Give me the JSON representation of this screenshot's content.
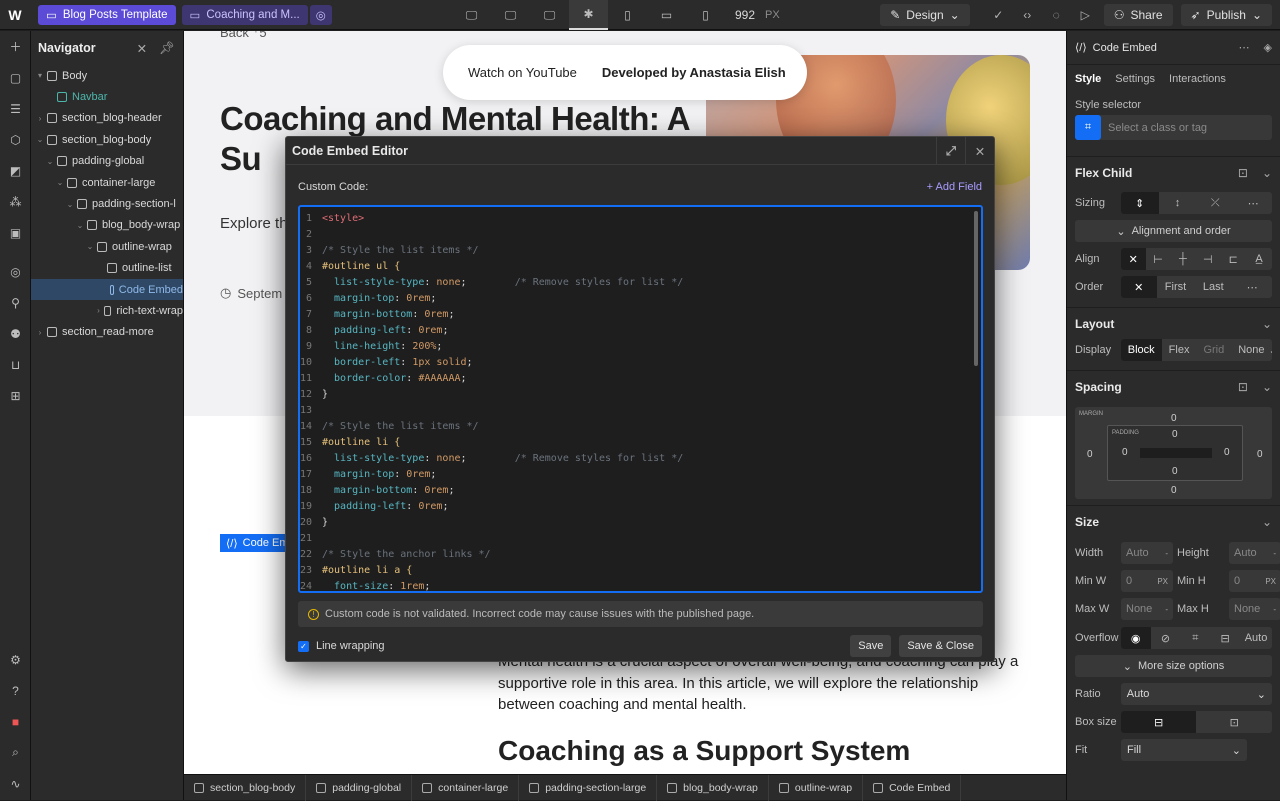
{
  "topbar": {
    "tabs": [
      "Blog Posts Template",
      "Coaching and M..."
    ],
    "breakpoint_size": "992",
    "breakpoint_unit": "PX",
    "mode_label": "Design",
    "share_label": "Share",
    "publish_label": "Publish"
  },
  "navigator": {
    "title": "Navigator",
    "items": [
      {
        "label": "Body",
        "depth": 0
      },
      {
        "label": "Navbar",
        "depth": 1
      },
      {
        "label": "section_blog-header",
        "depth": 1
      },
      {
        "label": "section_blog-body",
        "depth": 1
      },
      {
        "label": "padding-global",
        "depth": 2
      },
      {
        "label": "container-large",
        "depth": 3
      },
      {
        "label": "padding-section-l",
        "depth": 4
      },
      {
        "label": "blog_body-wrap",
        "depth": 5
      },
      {
        "label": "outline-wrap",
        "depth": 6
      },
      {
        "label": "outline-list",
        "depth": 7
      },
      {
        "label": "Code Embed",
        "depth": 7
      },
      {
        "label": "rich-text-wrap",
        "depth": 6
      },
      {
        "label": "section_read-more",
        "depth": 1
      }
    ]
  },
  "canvas": {
    "back_text": "Back ⁺5",
    "pill_left": "Watch on YouTube",
    "pill_right": "Developed by Anastasia Elish",
    "hero_title": "Coaching and Mental Health: A Su",
    "hero_sub": "Explore th how it can",
    "hero_date": "Septem",
    "code_embed_tag": "Code Emb",
    "body_text": "Mental health is a crucial aspect of overall well-being, and coaching can play a supportive role in this area. In this article, we will explore the relationship between coaching and mental health.",
    "h2": "Coaching as a Support System"
  },
  "breadcrumb": [
    "section_blog-body",
    "padding-global",
    "container-large",
    "padding-section-large",
    "blog_body-wrap",
    "outline-wrap",
    "Code Embed"
  ],
  "modal": {
    "title": "Code Embed Editor",
    "custom_code_label": "Custom Code:",
    "add_field": "+ Add Field",
    "code_lines": [
      "<style>",
      "",
      "/* Style the list items */",
      "#outline ul {",
      "  list-style-type: none;        /* Remove styles for list */",
      "  margin-top: 0rem;",
      "  margin-bottom: 0rem;",
      "  padding-left: 0rem;",
      "  line-height: 200%;",
      "  border-left: 1px solid;",
      "  border-color: #AAAAAA;",
      "}",
      "",
      "/* Style the list items */",
      "#outline li {",
      "  list-style-type: none;        /* Remove styles for list */",
      "  margin-top: 0rem;",
      "  margin-bottom: 0rem;",
      "  padding-left: 0rem;",
      "}",
      "",
      "/* Style the anchor links */",
      "#outline li a {",
      "  font-size: 1rem;"
    ],
    "warning": "Custom code is not validated. Incorrect code may cause issues with the published page.",
    "line_wrapping": "Line wrapping",
    "save": "Save",
    "save_close": "Save & Close"
  },
  "right_panel": {
    "element": "Code Embed",
    "tabs": [
      "Style",
      "Settings",
      "Interactions"
    ],
    "style_selector_label": "Style selector",
    "style_selector_placeholder": "Select a class or tag",
    "flex_child": {
      "title": "Flex Child",
      "sizing": "Sizing",
      "alignment": "Alignment and order",
      "align": "Align",
      "order": "Order",
      "first": "First",
      "last": "Last"
    },
    "layout": {
      "title": "Layout",
      "display": "Display",
      "options": [
        "Block",
        "Flex",
        "Grid",
        "None"
      ]
    },
    "spacing": {
      "title": "Spacing",
      "margin_label": "MARGIN",
      "padding_label": "PADDING",
      "values": [
        "0",
        "0",
        "0",
        "0",
        "0",
        "0",
        "0",
        "0"
      ]
    },
    "size": {
      "title": "Size",
      "width": "Width",
      "width_val": "Auto",
      "height": "Height",
      "height_val": "Auto",
      "minw": "Min W",
      "minw_val": "0",
      "minw_unit": "PX",
      "minh": "Min H",
      "minh_val": "0",
      "minh_unit": "PX",
      "maxw": "Max W",
      "maxw_val": "None",
      "maxh": "Max H",
      "maxh_val": "None",
      "overflow": "Overflow",
      "overflow_auto": "Auto",
      "more": "More size options",
      "ratio": "Ratio",
      "ratio_val": "Auto",
      "boxsize": "Box size",
      "fit": "Fit",
      "fit_val": "Fill"
    }
  }
}
